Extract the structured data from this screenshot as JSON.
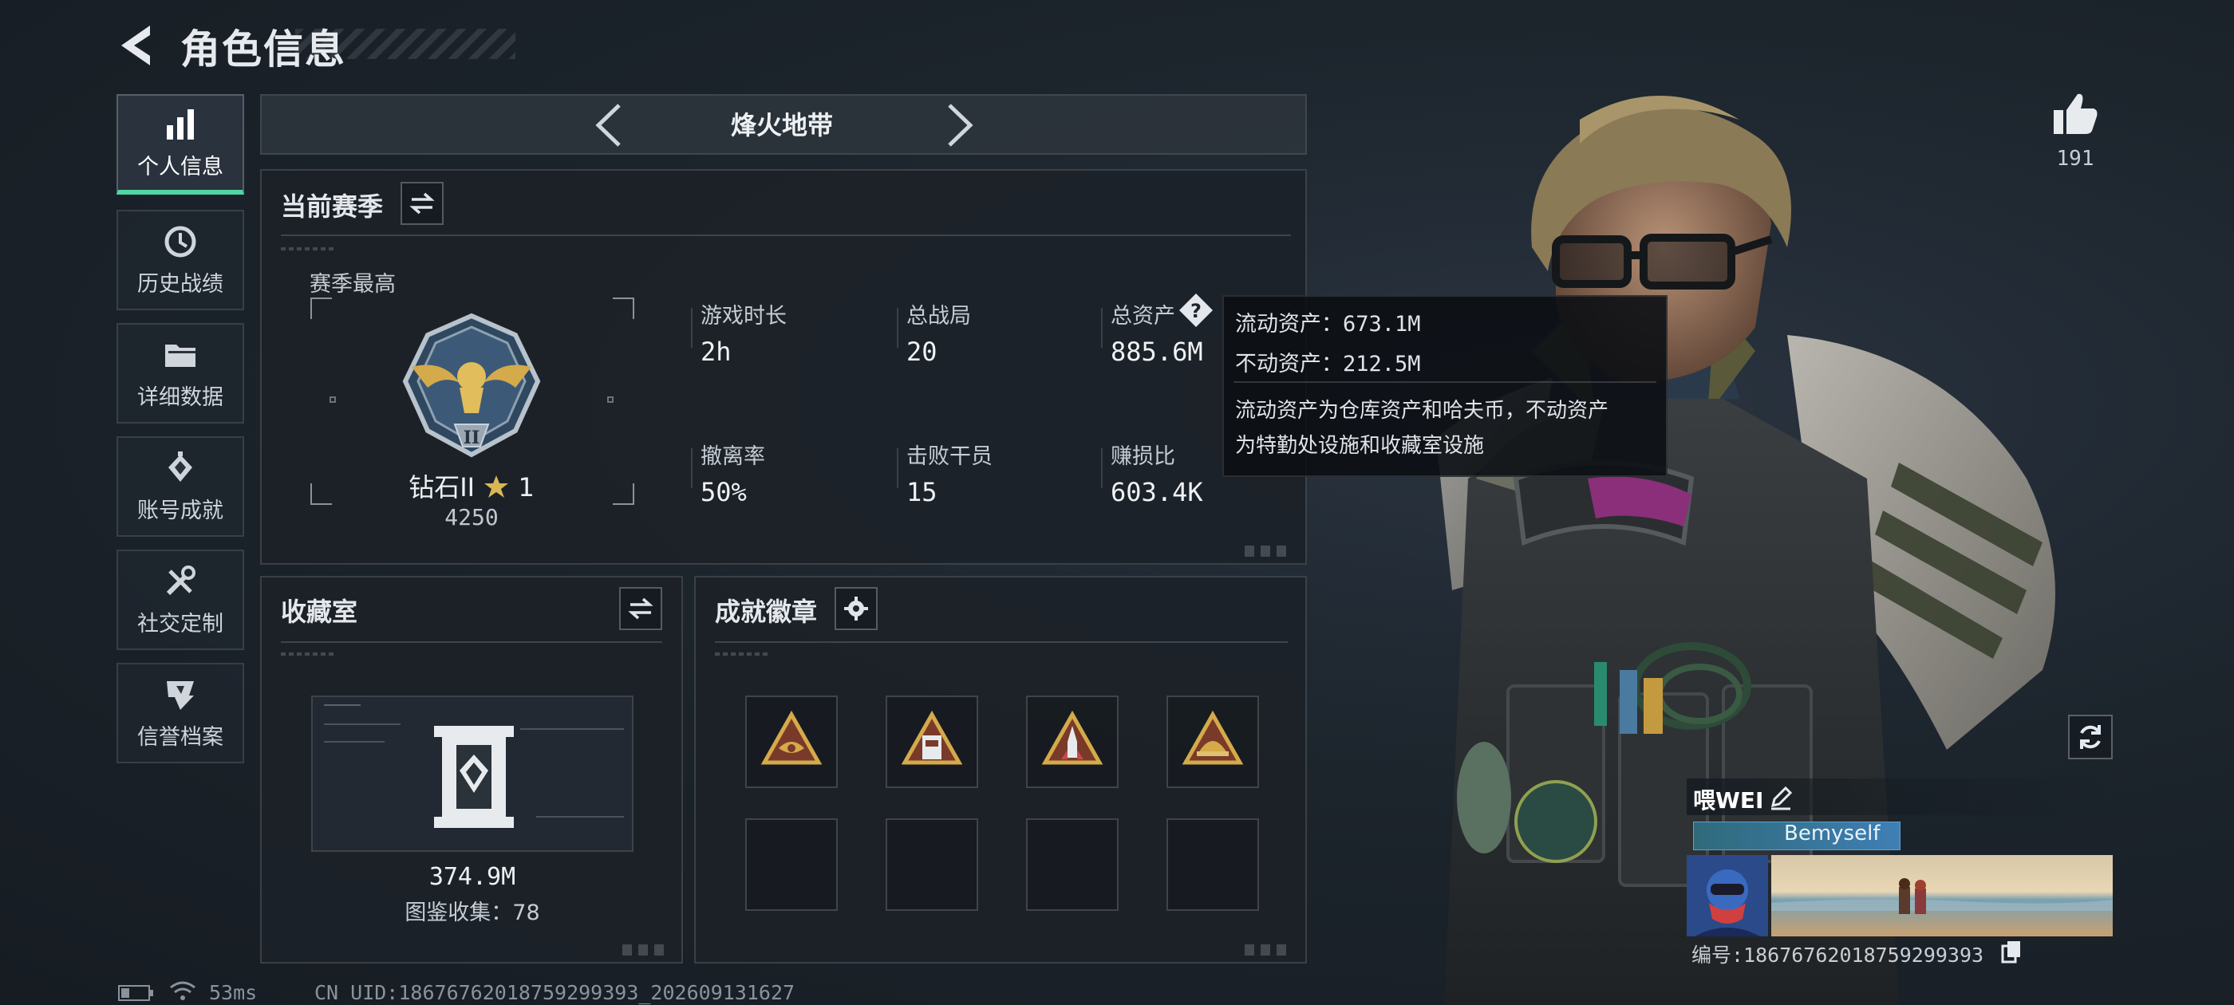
{
  "header": {
    "title": "角色信息"
  },
  "sidebar": {
    "items": [
      {
        "label": "个人信息",
        "icon": "bar-chart-icon",
        "active": true
      },
      {
        "label": "历史战绩",
        "icon": "history-icon",
        "active": false
      },
      {
        "label": "详细数据",
        "icon": "folder-icon",
        "active": false
      },
      {
        "label": "账号成就",
        "icon": "achievement-icon",
        "active": false
      },
      {
        "label": "社交定制",
        "icon": "tools-icon",
        "active": false
      },
      {
        "label": "信誉档案",
        "icon": "reputation-icon",
        "active": false
      }
    ]
  },
  "tabbar": {
    "title": "烽火地带"
  },
  "season": {
    "title": "当前赛季",
    "best_label": "赛季最高",
    "rank_name": "钻石II",
    "rank_stars": "1",
    "rank_points": "4250",
    "stats": [
      {
        "label": "游戏时长",
        "value": "2h"
      },
      {
        "label": "总战局",
        "value": "20"
      },
      {
        "label": "总资产",
        "value": "885.6M"
      },
      {
        "label": "撤离率",
        "value": "50%"
      },
      {
        "label": "击败干员",
        "value": "15"
      },
      {
        "label": "赚损比",
        "value": "603.4K"
      }
    ]
  },
  "tooltip": {
    "liquid_label": "流动资产：",
    "liquid_value": "673.1M",
    "fixed_label": "不动资产：",
    "fixed_value": "212.5M",
    "desc_line1": "流动资产为仓库资产和哈夫币，不动资产",
    "desc_line2": "为特勤处设施和收藏室设施"
  },
  "collection": {
    "title": "收藏室",
    "value": "374.9M",
    "catalog": "图鉴收集：78"
  },
  "badges": {
    "title": "成就徽章",
    "slots": [
      {
        "filled": true,
        "icon": "eye-pyramid-badge-icon"
      },
      {
        "filled": true,
        "icon": "card-pyramid-badge-icon"
      },
      {
        "filled": true,
        "icon": "rocket-pyramid-badge-icon"
      },
      {
        "filled": true,
        "icon": "helmet-pyramid-badge-icon"
      },
      {
        "filled": false
      },
      {
        "filled": false
      },
      {
        "filled": false
      },
      {
        "filled": false
      }
    ]
  },
  "likes": {
    "count": "191"
  },
  "player": {
    "name": "喂WEI",
    "tag": "Bemyself",
    "id_label": "编号:186767620187592993​93"
  },
  "status": {
    "ping": "53ms",
    "uid": "CN UID:18676762018759299393_202609131627"
  },
  "colors": {
    "accent_green": "#4fd6a4",
    "tag_blue": "#3f7fb5",
    "gold": "#d4aa4a"
  }
}
